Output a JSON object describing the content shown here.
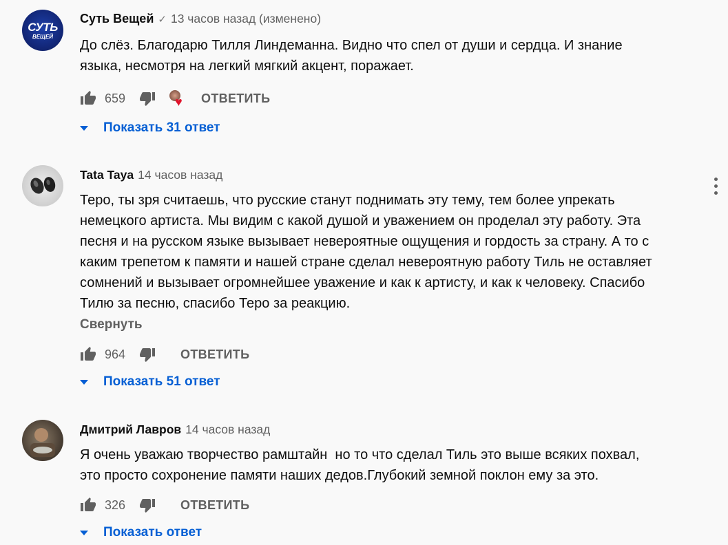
{
  "comments": [
    {
      "avatar_text": "СУТЬ",
      "avatar_subtext": "ВЕЩЕЙ",
      "author": "Суть Вещей",
      "verified_icon": "check-icon",
      "time": "13 часов назад (изменено)",
      "text": "До слёз. Благодарю Тилля Линдеманна. Видно что спел от души и сердца. И знание\nязыка, несмотря на легкий мягкий акцент, поражает.",
      "likes": "659",
      "reply_label": "ОТВЕТИТЬ",
      "show_replies": "Показать 31 ответ"
    },
    {
      "author": "Tata Taya",
      "time": "14 часов назад",
      "text": "Теро, ты зря считаешь, что русские станут поднимать эту тему, тем более упрекать\nнемецкого артиста. Мы видим с какой душой и уважением он проделал эту работу. Эта\nпесня и на русском языке вызывает невероятные ощущения и гордость за страну. А то с\nкаким трепетом к памяти и нашей стране сделал невероятную работу Тиль не оставляет\nсомнений и вызывает огромнейшее уважение и как к артисту, и как к человеку. Спасибо\nТилю за песню, спасибо Теро за реакцию.",
      "collapse_label": "Свернуть",
      "likes": "964",
      "reply_label": "ОТВЕТИТЬ",
      "show_replies": "Показать 51 ответ"
    },
    {
      "author": "Дмитрий Лавров",
      "time": "14 часов назад",
      "text": "Я очень уважаю творчество рамштайн  но то что сделал Тиль это выше всяких похвал,\nэто просто сохронение памяти наших дедов.Глубокий земной поклон ему за это.",
      "likes": "326",
      "reply_label": "ОТВЕТИТЬ",
      "show_replies": "Показать ответ"
    }
  ],
  "colors": {
    "background": "#f9f9f9",
    "link_blue": "#065fd4",
    "secondary_text": "#606060",
    "heart_red": "#e0142b"
  }
}
